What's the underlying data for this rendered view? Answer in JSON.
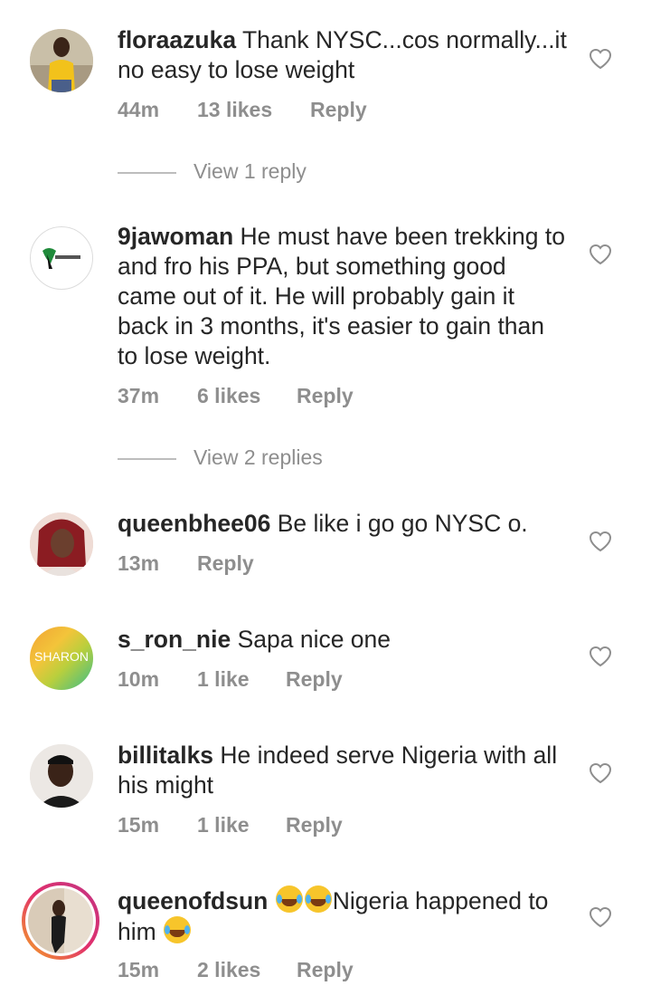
{
  "comments": [
    {
      "username": "floraazuka",
      "text": "Thank NYSC...cos normally...it no easy to lose weight",
      "time": "44m",
      "likes": "13 likes",
      "reply": "Reply",
      "view_replies": "View 1 reply",
      "avatar": "photo-woman-yellow-shirt"
    },
    {
      "username": "9jawoman",
      "text": "He must have been trekking to and fro his PPA, but something good came out of it. He will probably gain it back in 3 months, it's easier to gain than to lose weight.",
      "time": "37m",
      "likes": "6 likes",
      "reply": "Reply",
      "view_replies": "View 2 replies",
      "avatar": "9jawoman-logo"
    },
    {
      "username": "queenbhee06",
      "text": "Be like i go go NYSC o.",
      "time": "13m",
      "reply": "Reply",
      "avatar": "photo-woman-red-braids"
    },
    {
      "username": "s_ron_nie",
      "text": "Sapa nice one",
      "time": "10m",
      "likes": "1 like",
      "reply": "Reply",
      "avatar_text": "SHARON"
    },
    {
      "username": "billitalks",
      "text": "He indeed serve Nigeria with all his might",
      "time": "15m",
      "likes": "1 like",
      "reply": "Reply",
      "avatar": "photo-man"
    },
    {
      "username": "queenofdsun",
      "text_after_emoji": "Nigeria happened to him",
      "time": "15m",
      "likes": "2 likes",
      "reply": "Reply",
      "avatar": "photo-woman-story-ring",
      "emoji": "face-with-tears-of-joy"
    }
  ],
  "colors": {
    "text": "#262626",
    "meta": "#8e8e8e",
    "heart": "#8e8e8e"
  },
  "icons": {
    "like": "heart-outline-icon"
  }
}
